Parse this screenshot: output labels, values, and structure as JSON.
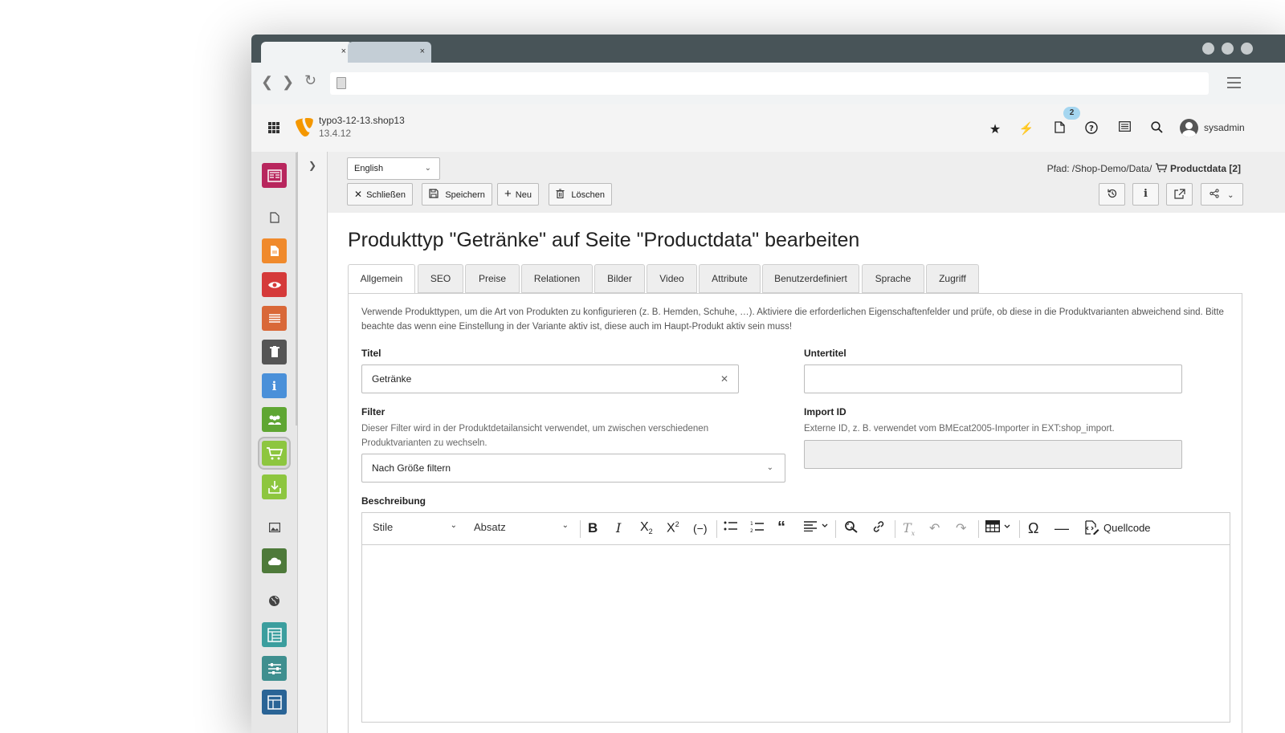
{
  "browser": {
    "tabs": [
      {
        "close": "×"
      },
      {
        "close": "×"
      }
    ]
  },
  "header": {
    "site_name": "typo3-12-13.shop13",
    "version": "13.4.12",
    "notification_count": "2",
    "username": "sysadmin"
  },
  "docheader": {
    "language": "English",
    "buttons": {
      "close": "Schließen",
      "save": "Speichern",
      "new": "Neu",
      "delete": "Löschen"
    },
    "path_prefix": "Pfad: /Shop-Demo/Data/",
    "path_record": "Productdata [2]"
  },
  "main": {
    "title": "Produkttyp \"Getränke\" auf Seite \"Productdata\" bearbeiten",
    "tabs": [
      {
        "label": "Allgemein"
      },
      {
        "label": "SEO"
      },
      {
        "label": "Preise"
      },
      {
        "label": "Relationen"
      },
      {
        "label": "Bilder"
      },
      {
        "label": "Video"
      },
      {
        "label": "Attribute"
      },
      {
        "label": "Benutzerdefiniert"
      },
      {
        "label": "Sprache"
      },
      {
        "label": "Zugriff"
      }
    ],
    "description": "Verwende Produkttypen, um die Art von Produkten zu konfigurieren (z. B. Hemden, Schuhe, …). Aktiviere die erforderlichen Eigenschaftenfelder und prüfe, ob diese in die Produktvarianten abweichend sind. Bitte beachte das wenn eine Einstellung in der Variante aktiv ist, diese auch im Haupt-Produkt aktiv sein muss!",
    "fields": {
      "title_label": "Titel",
      "title_value": "Getränke",
      "subtitle_label": "Untertitel",
      "subtitle_value": "",
      "filter_label": "Filter",
      "filter_help": "Dieser Filter wird in der Produktdetailansicht verwendet, um zwischen verschiedenen Produktvarianten zu wechseln.",
      "filter_value": "Nach Größe filtern",
      "import_label": "Import ID",
      "import_help": "Externe ID, z. B. verwendet vom BMEcat2005-Importer in EXT:shop_import.",
      "import_value": "",
      "description_label": "Beschreibung"
    },
    "rte": {
      "styles": "Stile",
      "format": "Absatz",
      "source": "Quellcode"
    }
  },
  "colors": {
    "tabstrip": "#485458",
    "accent_shop": "#8dc63f"
  }
}
